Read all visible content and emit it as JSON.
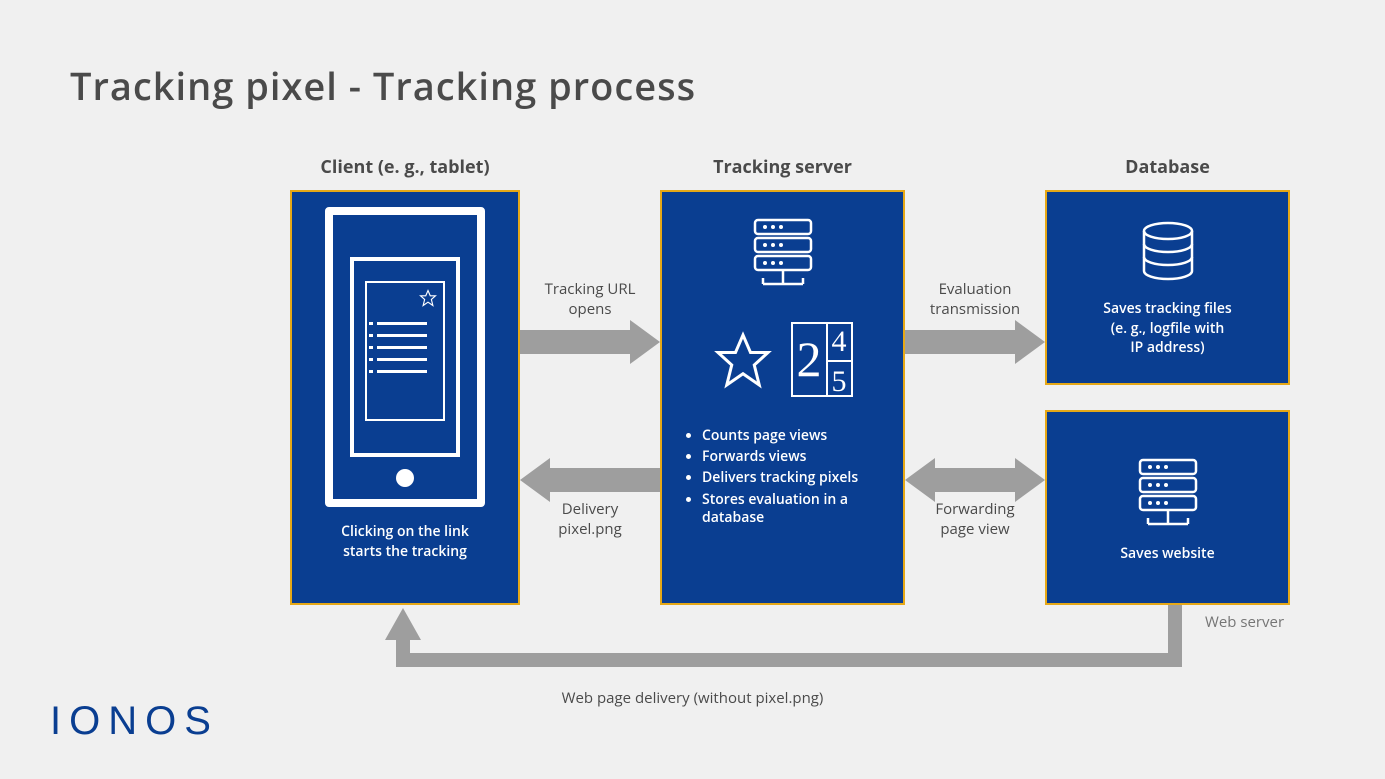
{
  "title": "Tracking pixel - Tracking process",
  "columns": {
    "client_label": "Client (e. g., tablet)",
    "server_label": "Tracking server",
    "database_label": "Database"
  },
  "client": {
    "caption_line1": "Clicking on the link",
    "caption_line2": "starts the tracking"
  },
  "server": {
    "bullets": [
      "Counts page views",
      "Forwards views",
      "Delivers tracking pixels",
      "Stores evaluation in a database"
    ],
    "num_big": "2",
    "num_small_top": "4",
    "num_small_bottom": "5"
  },
  "database": {
    "line1": "Saves tracking files",
    "line2": "(e. g., logfile with",
    "line3": "IP address)"
  },
  "webserver": {
    "caption": "Saves website",
    "label": "Web server"
  },
  "arrows": {
    "tracking_url_l1": "Tracking URL",
    "tracking_url_l2": "opens",
    "delivery_l1": "Delivery",
    "delivery_l2": "pixel.png",
    "eval_l1": "Evaluation",
    "eval_l2": "transmission",
    "forward_l1": "Forwarding",
    "forward_l2": "page view",
    "bottom": "Web page delivery (without pixel.png)"
  },
  "brand": "IONOS",
  "colors": {
    "box_bg": "#0a3e91",
    "box_border": "#e6a817",
    "arrow": "#9e9e9e",
    "text": "#4a4a4a"
  }
}
